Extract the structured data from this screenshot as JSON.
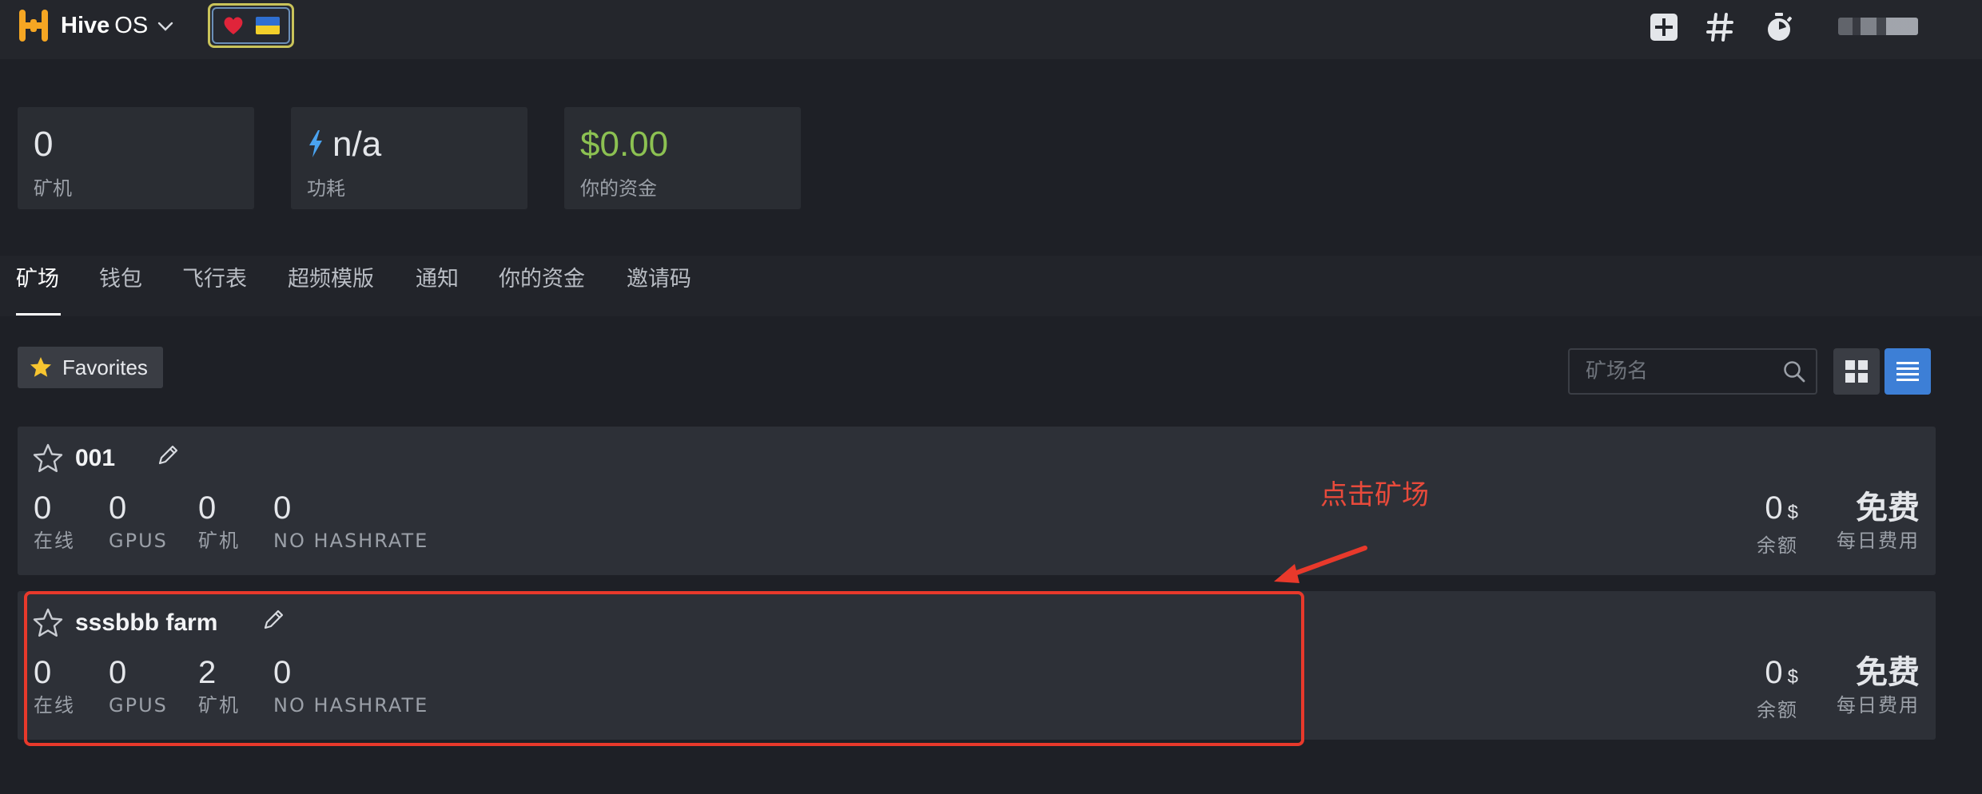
{
  "topbar": {
    "brand_name": "Hive",
    "brand_suffix": "OS",
    "icons": [
      "add-square-icon",
      "hash-icon",
      "stopwatch-icon"
    ]
  },
  "stats": [
    {
      "value": "0",
      "label": "矿机"
    },
    {
      "value": "n/a",
      "label": "功耗"
    },
    {
      "value": "$0.00",
      "label": "你的资金"
    }
  ],
  "tabs": [
    {
      "label": "矿场",
      "active": true
    },
    {
      "label": "钱包"
    },
    {
      "label": "飞行表"
    },
    {
      "label": "超频模版"
    },
    {
      "label": "通知"
    },
    {
      "label": "你的资金"
    },
    {
      "label": "邀请码"
    }
  ],
  "toolbar": {
    "favorites_label": "Favorites",
    "search_placeholder": "矿场名"
  },
  "farms": [
    {
      "name": "001",
      "online": "0",
      "online_label": "在线",
      "gpus": "0",
      "gpus_label": "GPUS",
      "rigs": "0",
      "rigs_label": "矿机",
      "hashrate": "0",
      "hashrate_label": "NO HASHRATE",
      "balance": "0",
      "balance_unit": "$",
      "balance_label": "余额",
      "fee": "免费",
      "fee_label": "每日费用"
    },
    {
      "name": "sssbbb farm",
      "online": "0",
      "online_label": "在线",
      "gpus": "0",
      "gpus_label": "GPUS",
      "rigs": "2",
      "rigs_label": "矿机",
      "hashrate": "0",
      "hashrate_label": "NO HASHRATE",
      "balance": "0",
      "balance_unit": "$",
      "balance_label": "余额",
      "fee": "免费",
      "fee_label": "每日费用"
    }
  ],
  "annotation": {
    "text": "点击矿场",
    "color": "#e8392b"
  },
  "colors": {
    "accent_blue": "#3d7fd6",
    "money_green": "#8cc152",
    "logo_orange": "#f5a623"
  }
}
